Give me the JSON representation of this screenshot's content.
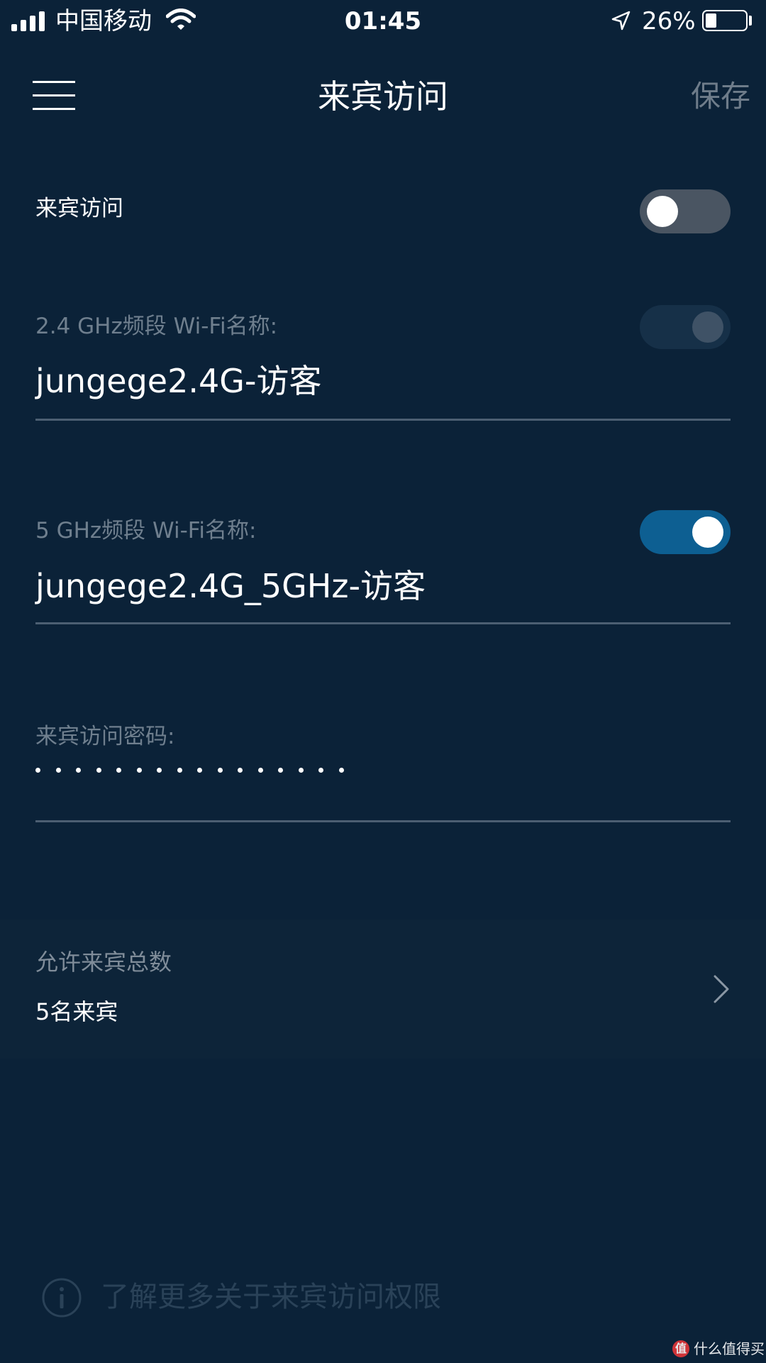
{
  "status_bar": {
    "carrier": "中国移动",
    "time": "01:45",
    "battery_percent": "26%",
    "battery_level": 0.26
  },
  "nav": {
    "title": "来宾访问",
    "save_label": "保存"
  },
  "guest_access": {
    "label": "来宾访问",
    "enabled": false
  },
  "band_24": {
    "label": "2.4 GHz频段 Wi-Fi名称:",
    "ssid": "jungege2.4G-访客",
    "enabled": true,
    "disabled_state": true
  },
  "band_5": {
    "label": "5 GHz频段 Wi-Fi名称:",
    "ssid": "jungege2.4G_5GHz-访客",
    "enabled": true
  },
  "password": {
    "label": "来宾访问密码:",
    "masked_length": 16
  },
  "guest_limit": {
    "label": "允许来宾总数",
    "value": "5名来宾"
  },
  "footer": {
    "learn_more": "了解更多关于来宾访问权限"
  },
  "watermark": {
    "logo_text": "值",
    "text": "什么值得买"
  },
  "colors": {
    "background": "#0b2238",
    "toggle_on": "#0d5f92",
    "toggle_off": "#4a5562",
    "dim_text": "#6f7f8e"
  }
}
